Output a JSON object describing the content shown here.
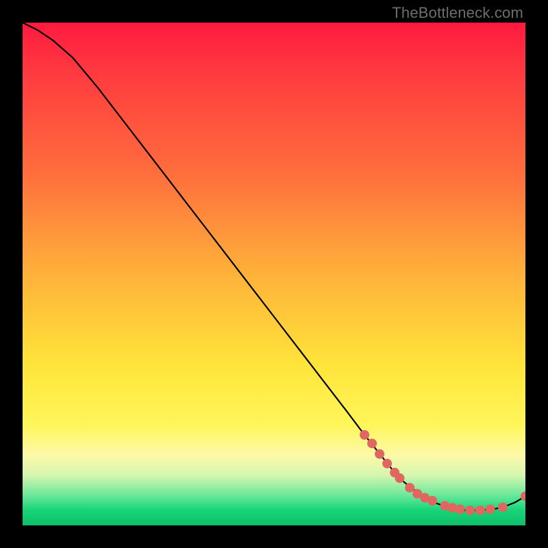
{
  "watermark": "TheBottleneck.com",
  "colors": {
    "background": "#000000",
    "curve": "#000000",
    "marker": "#e0675f",
    "gradient_top": "#ff1a3f",
    "gradient_bottom": "#0fbf6a"
  },
  "chart_data": {
    "type": "line",
    "title": "",
    "xlabel": "",
    "ylabel": "",
    "xlim": [
      0,
      100
    ],
    "ylim": [
      0,
      100
    ],
    "grid": false,
    "legend": false,
    "series": [
      {
        "name": "curve",
        "x": [
          0,
          3,
          6,
          10,
          15,
          20,
          25,
          30,
          35,
          40,
          45,
          50,
          55,
          60,
          65,
          68,
          70,
          72,
          74,
          76,
          78,
          80,
          82,
          84,
          86,
          88,
          90,
          92,
          94,
          96,
          98,
          100
        ],
        "y": [
          100,
          98.5,
          96.5,
          93,
          87,
          80.5,
          74,
          67.5,
          61,
          54.5,
          48,
          41.5,
          35,
          28.5,
          22,
          18,
          15.5,
          13,
          10.5,
          8.5,
          7,
          5.5,
          4.5,
          3.8,
          3.3,
          3.0,
          3.0,
          3.1,
          3.3,
          3.8,
          4.6,
          5.8
        ]
      }
    ],
    "markers": [
      {
        "x": 68,
        "y": 18
      },
      {
        "x": 69.5,
        "y": 16.3
      },
      {
        "x": 71,
        "y": 14.2
      },
      {
        "x": 72.5,
        "y": 12.3
      },
      {
        "x": 74,
        "y": 10.5
      },
      {
        "x": 75,
        "y": 9.4
      },
      {
        "x": 77,
        "y": 7.5
      },
      {
        "x": 78.5,
        "y": 6.3
      },
      {
        "x": 80,
        "y": 5.5
      },
      {
        "x": 81.5,
        "y": 4.9
      },
      {
        "x": 84,
        "y": 3.9
      },
      {
        "x": 85.5,
        "y": 3.5
      },
      {
        "x": 87,
        "y": 3.2
      },
      {
        "x": 89,
        "y": 3.0
      },
      {
        "x": 91,
        "y": 3.0
      },
      {
        "x": 93,
        "y": 3.2
      },
      {
        "x": 95.5,
        "y": 3.6
      },
      {
        "x": 100,
        "y": 5.8
      }
    ]
  }
}
